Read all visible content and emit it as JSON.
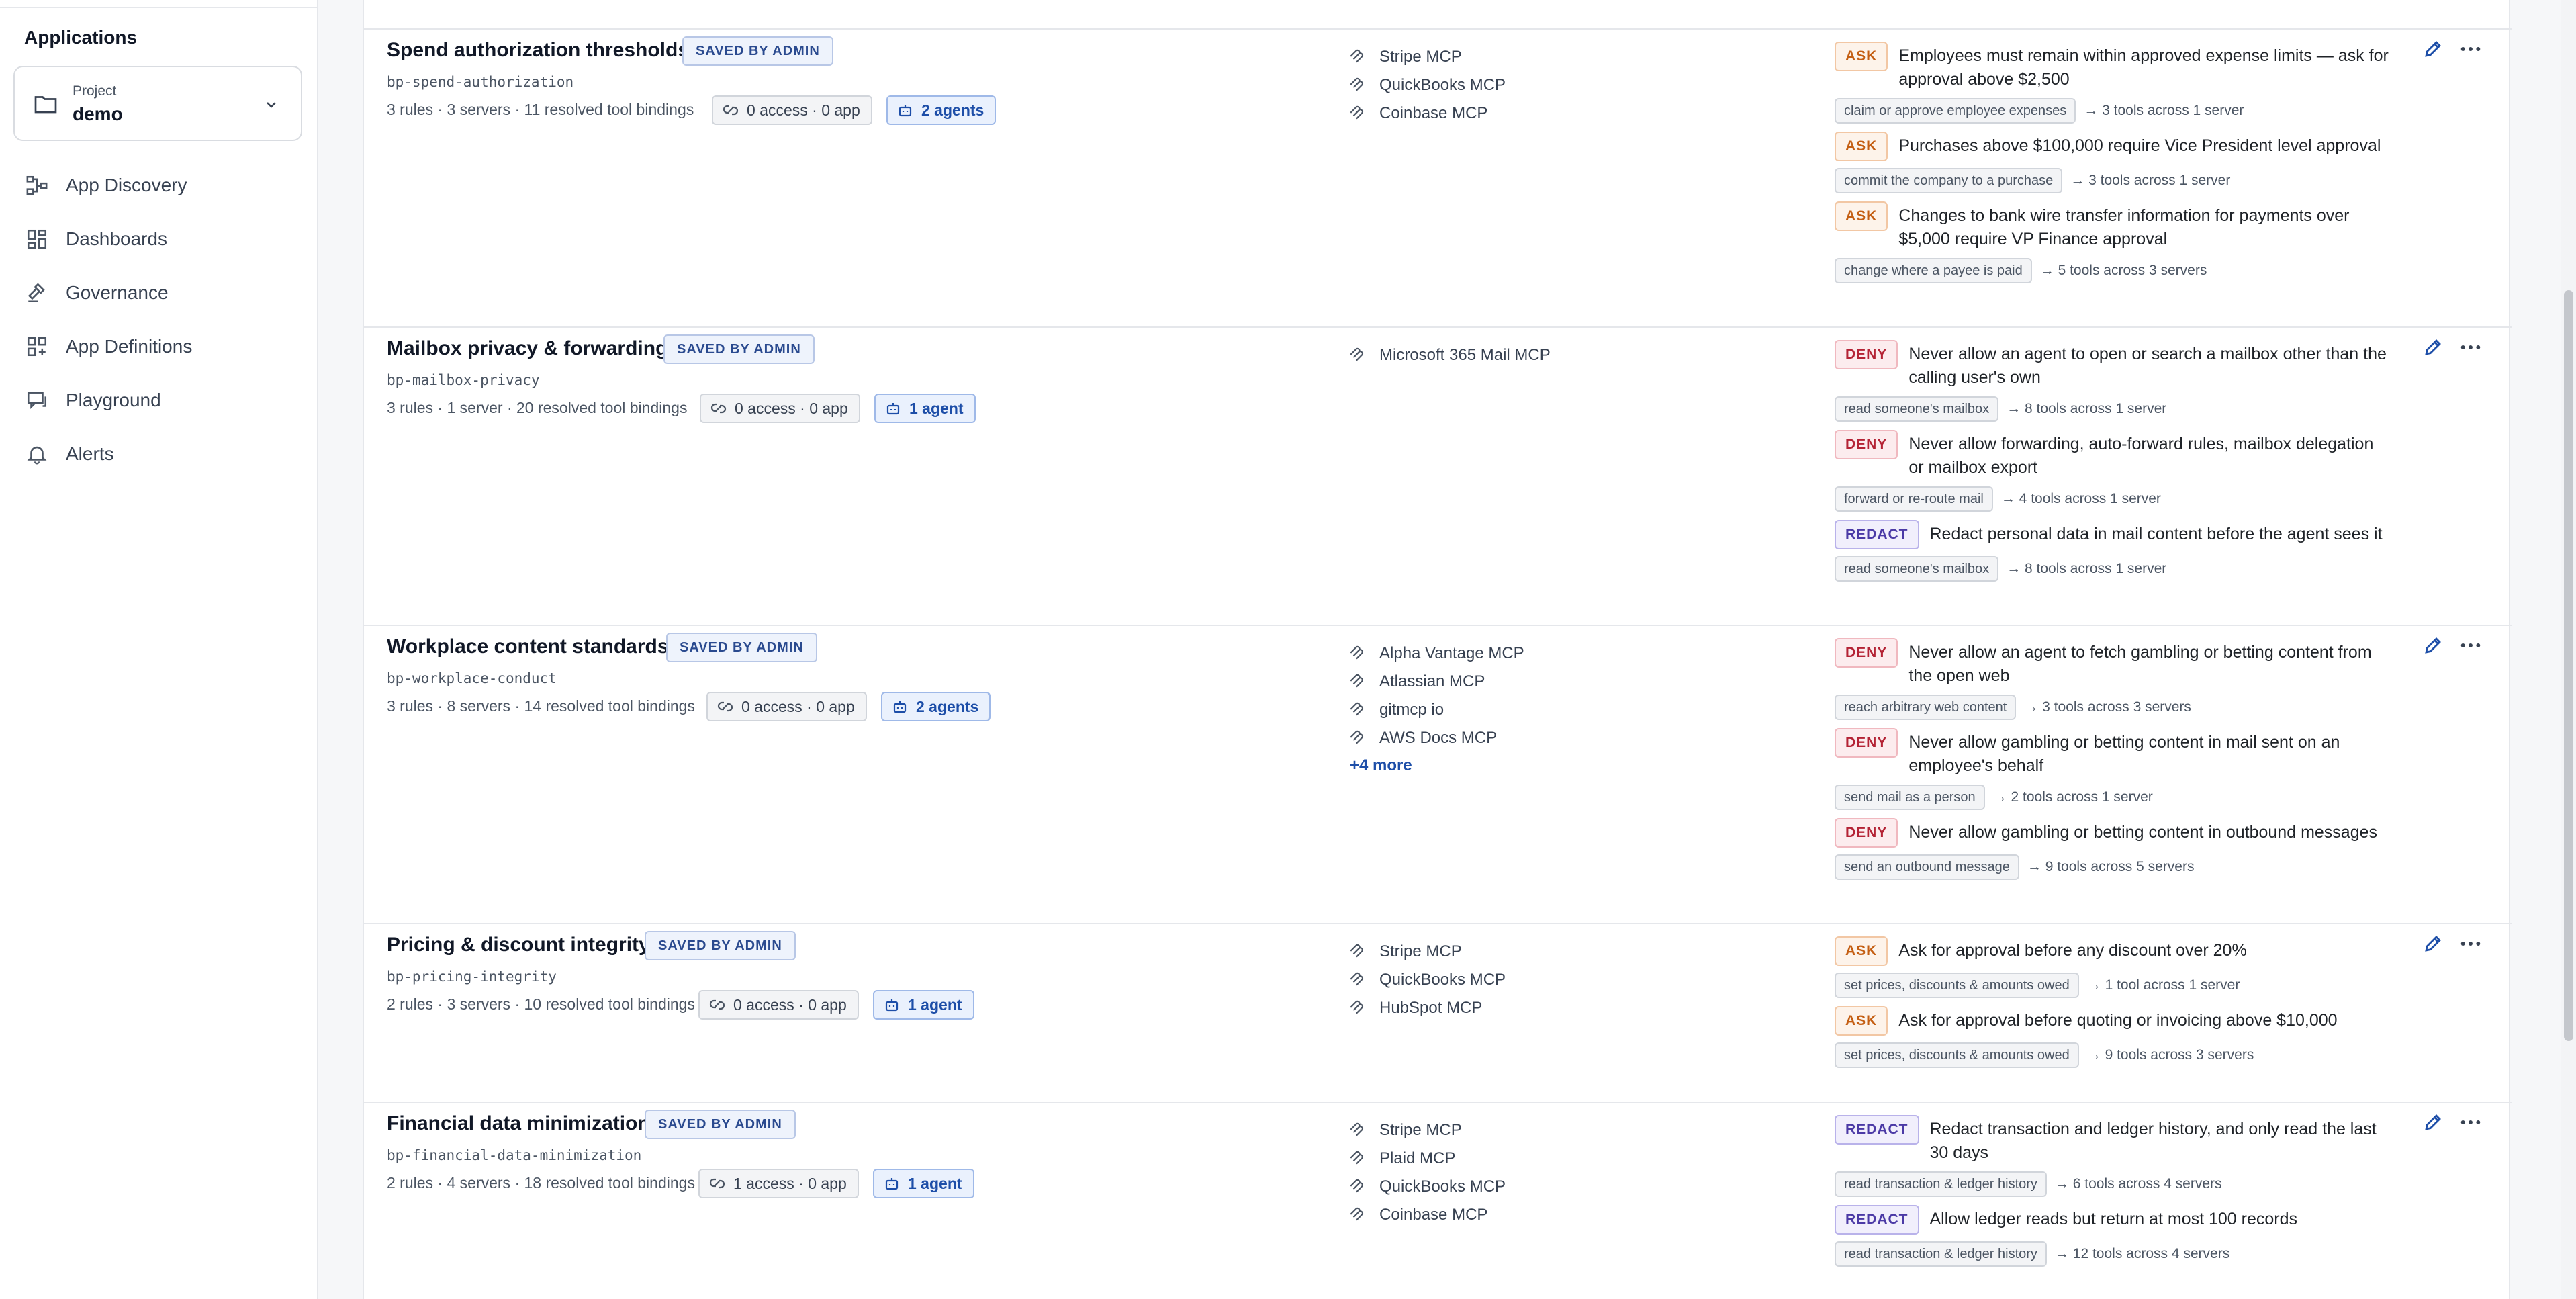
{
  "sidebar": {
    "section_title": "Applications",
    "project": {
      "label": "Project",
      "value": "demo"
    },
    "items": [
      {
        "label": "App Discovery",
        "icon": "flow-icon"
      },
      {
        "label": "Dashboards",
        "icon": "dashboard-icon"
      },
      {
        "label": "Governance",
        "icon": "gavel-icon"
      },
      {
        "label": "App Definitions",
        "icon": "grid-plus-icon"
      },
      {
        "label": "Playground",
        "icon": "chat-icon"
      },
      {
        "label": "Alerts",
        "icon": "bell-icon"
      }
    ]
  },
  "policies": [
    {
      "name": "Spend authorization thresholds",
      "badge": "SAVED BY ADMIN",
      "slug": "bp-spend-authorization",
      "stats": "3 rules · 3 servers · 11 resolved tool bindings",
      "access": "0 access · 0 app",
      "agents": "2 agents",
      "servers": [
        "Stripe MCP",
        "QuickBooks MCP",
        "Coinbase MCP"
      ],
      "more": "",
      "rules": [
        {
          "type": "ASK",
          "text": "Employees must remain within approved expense limits — ask for approval above $2,500",
          "capability": "claim or approve employee expenses",
          "reach": "→ 3 tools across 1 server"
        },
        {
          "type": "ASK",
          "text": "Purchases above $100,000 require Vice President level approval",
          "capability": "commit the company to a purchase",
          "reach": "→ 3 tools across 1 server"
        },
        {
          "type": "ASK",
          "text": "Changes to bank wire transfer information for payments over $5,000 require VP Finance approval",
          "capability": "change where a payee is paid",
          "reach": "→ 5 tools across 3 servers"
        }
      ]
    },
    {
      "name": "Mailbox privacy & forwarding",
      "badge": "SAVED BY ADMIN",
      "slug": "bp-mailbox-privacy",
      "stats": "3 rules · 1 server · 20 resolved tool bindings",
      "access": "0 access · 0 app",
      "agents": "1 agent",
      "servers": [
        "Microsoft 365 Mail MCP"
      ],
      "more": "",
      "rules": [
        {
          "type": "DENY",
          "text": "Never allow an agent to open or search a mailbox other than the calling user's own",
          "capability": "read someone's mailbox",
          "reach": "→ 8 tools across 1 server"
        },
        {
          "type": "DENY",
          "text": "Never allow forwarding, auto-forward rules, mailbox delegation or mailbox export",
          "capability": "forward or re-route mail",
          "reach": "→ 4 tools across 1 server"
        },
        {
          "type": "REDACT",
          "text": "Redact personal data in mail content before the agent sees it",
          "capability": "read someone's mailbox",
          "reach": "→ 8 tools across 1 server"
        }
      ]
    },
    {
      "name": "Workplace content standards",
      "badge": "SAVED BY ADMIN",
      "slug": "bp-workplace-conduct",
      "stats": "3 rules · 8 servers · 14 resolved tool bindings",
      "access": "0 access · 0 app",
      "agents": "2 agents",
      "servers": [
        "Alpha Vantage MCP",
        "Atlassian MCP",
        "gitmcp io",
        "AWS Docs MCP"
      ],
      "more": "+4 more",
      "rules": [
        {
          "type": "DENY",
          "text": "Never allow an agent to fetch gambling or betting content from the open web",
          "capability": "reach arbitrary web content",
          "reach": "→ 3 tools across 3 servers"
        },
        {
          "type": "DENY",
          "text": "Never allow gambling or betting content in mail sent on an employee's behalf",
          "capability": "send mail as a person",
          "reach": "→ 2 tools across 1 server"
        },
        {
          "type": "DENY",
          "text": "Never allow gambling or betting content in outbound messages",
          "capability": "send an outbound message",
          "reach": "→ 9 tools across 5 servers"
        }
      ]
    },
    {
      "name": "Pricing & discount integrity",
      "badge": "SAVED BY ADMIN",
      "slug": "bp-pricing-integrity",
      "stats": "2 rules · 3 servers · 10 resolved tool bindings",
      "access": "0 access · 0 app",
      "agents": "1 agent",
      "servers": [
        "Stripe MCP",
        "QuickBooks MCP",
        "HubSpot MCP"
      ],
      "more": "",
      "rules": [
        {
          "type": "ASK",
          "text": "Ask for approval before any discount over 20%",
          "capability": "set prices, discounts & amounts owed",
          "reach": "→ 1 tool across 1 server"
        },
        {
          "type": "ASK",
          "text": "Ask for approval before quoting or invoicing above $10,000",
          "capability": "set prices, discounts & amounts owed",
          "reach": "→ 9 tools across 3 servers"
        }
      ]
    },
    {
      "name": "Financial data minimization",
      "badge": "SAVED BY ADMIN",
      "slug": "bp-financial-data-minimization",
      "stats": "2 rules · 4 servers · 18 resolved tool bindings",
      "access": "1 access · 0 app",
      "agents": "1 agent",
      "servers": [
        "Stripe MCP",
        "Plaid MCP",
        "QuickBooks MCP",
        "Coinbase MCP"
      ],
      "more": "",
      "rules": [
        {
          "type": "REDACT",
          "text": "Redact transaction and ledger history, and only read the last 30 days",
          "capability": "read transaction & ledger history",
          "reach": "→ 6 tools across 4 servers"
        },
        {
          "type": "REDACT",
          "text": "Allow ledger reads but return at most 100 records",
          "capability": "read transaction & ledger history",
          "reach": "→ 12 tools across 4 servers"
        }
      ]
    }
  ]
}
